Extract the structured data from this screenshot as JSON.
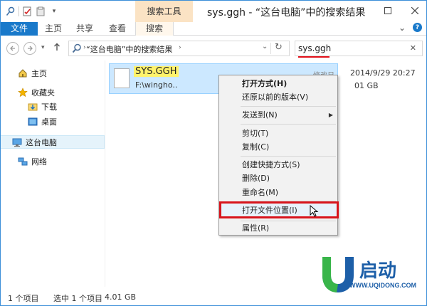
{
  "window": {
    "title": "sys.ggh - “这台电脑”中的搜索结果",
    "contextual_tab_group": "搜索工具"
  },
  "ribbon": {
    "tabs": [
      {
        "label": "文件"
      },
      {
        "label": "主页"
      },
      {
        "label": "共享"
      },
      {
        "label": "查看"
      },
      {
        "label": "搜索"
      }
    ]
  },
  "address": {
    "breadcrumb": "“这台电脑”中的搜索结果",
    "search_value": "sys.ggh"
  },
  "nav": {
    "items": [
      {
        "label": "主页",
        "icon": "home-icon"
      },
      {
        "label": "收藏夹",
        "icon": "star-icon"
      },
      {
        "label": "下载",
        "icon": "download-folder-icon"
      },
      {
        "label": "桌面",
        "icon": "desktop-icon"
      },
      {
        "label": "这台电脑",
        "icon": "computer-icon"
      },
      {
        "label": "网络",
        "icon": "network-icon"
      }
    ],
    "selected": "这台电脑"
  },
  "file": {
    "name": "SYS.GGH",
    "path": "F:\\wingho..",
    "date_label": "修改日期:",
    "date": "2014/9/29 20:27",
    "size": "01 GB"
  },
  "context_menu": {
    "items": [
      {
        "label": "打开方式(H)",
        "bold": true
      },
      {
        "label": "还原以前的版本(V)"
      },
      {
        "label": "发送到(N)",
        "submenu": true
      },
      {
        "label": "剪切(T)"
      },
      {
        "label": "复制(C)"
      },
      {
        "label": "创建快捷方式(S)"
      },
      {
        "label": "删除(D)"
      },
      {
        "label": "重命名(M)"
      },
      {
        "label": "打开文件位置(I)",
        "highlighted": true
      },
      {
        "label": "属性(R)"
      }
    ]
  },
  "status": {
    "count": "1 个项目",
    "selected": "选中 1 个项目",
    "size": "4.01 GB"
  },
  "watermark": {
    "url": "WWW.UQIDONG.COM"
  },
  "colors": {
    "accent": "#1979ca",
    "selection": "#cce8ff",
    "highlight_box": "#d8141c",
    "search_underline": "#e2101a"
  }
}
